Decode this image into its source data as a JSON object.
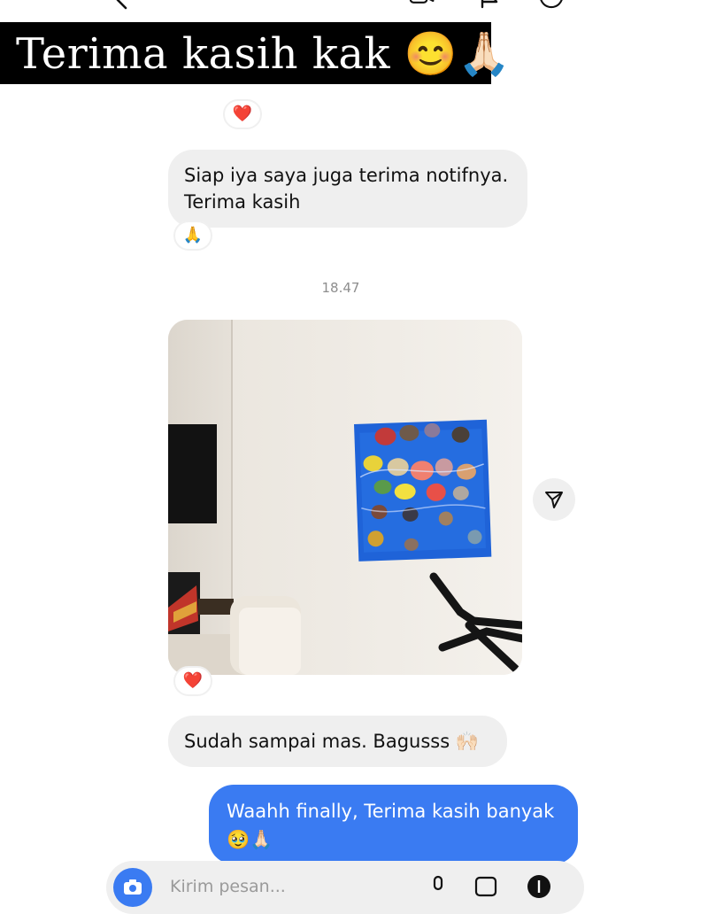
{
  "caption": {
    "text": "Terima kasih kak 😊🙏🏻"
  },
  "messages": {
    "first_reaction": "❤️",
    "msg1": {
      "line1": "Siap iya saya juga terima notifnya.",
      "line2": "Terima kasih",
      "reaction": "🙏"
    },
    "timestamp": "18.47",
    "photo_reaction": "❤️",
    "msg2": {
      "text": "Sudah sampai mas. Bagusss 🙌🏻"
    },
    "msg3": {
      "line1": "Waahh finally, Terima kasih banyak",
      "line2": "🥹🙏🏻"
    }
  },
  "composer": {
    "placeholder": "Kirim pesan..."
  },
  "icons": {
    "back": "chevron-left-icon",
    "video": "video-camera-icon",
    "flag": "flag-icon",
    "info": "info-icon",
    "share": "paper-plane-icon",
    "camera": "camera-icon",
    "mic": "microphone-icon",
    "gallery": "image-icon",
    "add": "plus-circle-icon"
  },
  "colors": {
    "outgoing_bubble": "#3a7bf2",
    "incoming_bubble": "#efefef",
    "caption_background": "#000000"
  }
}
